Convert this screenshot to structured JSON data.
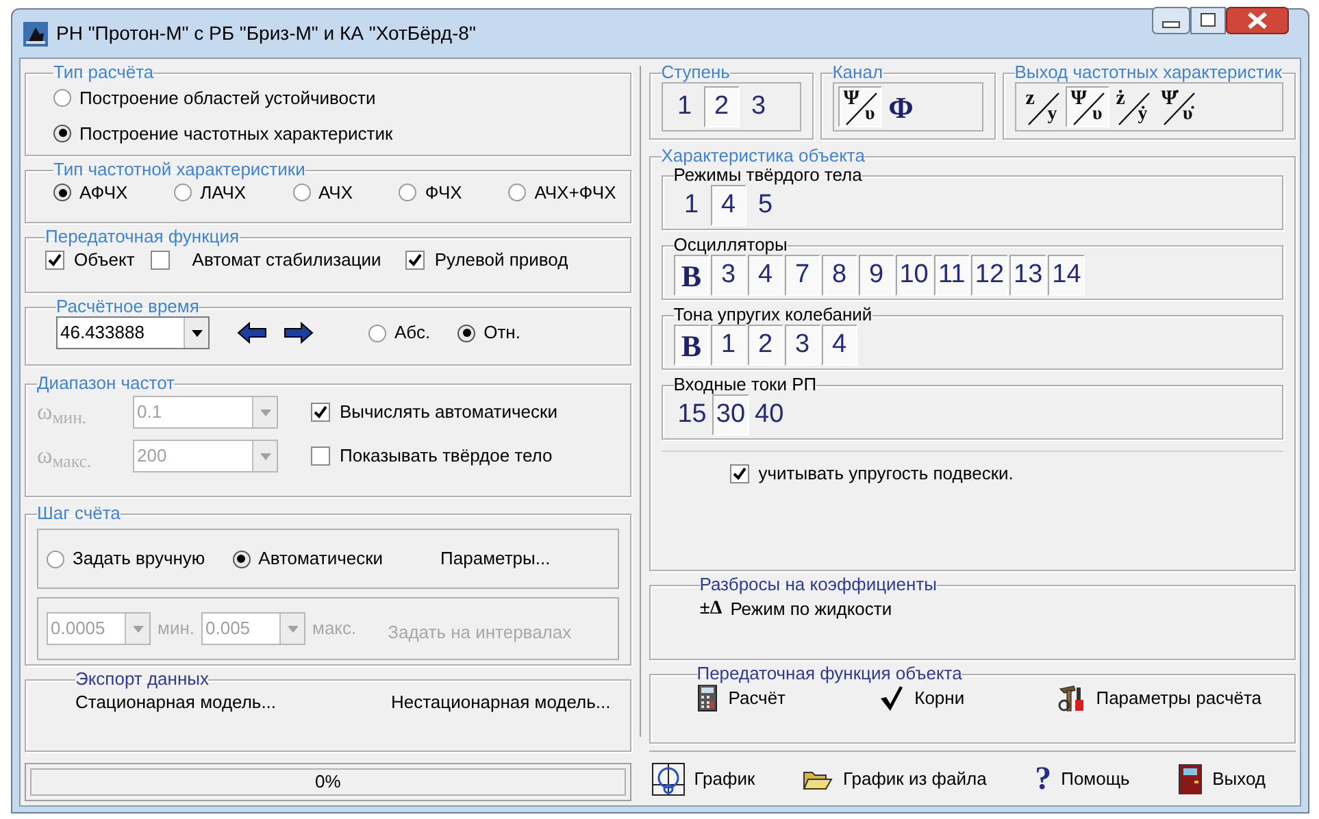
{
  "window": {
    "title": "РН \"Протон-М\" с РБ \"Бриз-М\" и КА \"ХотБёрд-8\""
  },
  "calc_type": {
    "legend": "Тип расчёта",
    "options": [
      {
        "label": "Построение областей устойчивости",
        "selected": false
      },
      {
        "label": "Построение частотных характеристик",
        "selected": true
      }
    ]
  },
  "freq_char_type": {
    "legend": "Тип частотной характеристики",
    "options": [
      {
        "label": "АФЧХ",
        "selected": true
      },
      {
        "label": "ЛАЧХ",
        "selected": false
      },
      {
        "label": "АЧХ",
        "selected": false
      },
      {
        "label": "ФЧХ",
        "selected": false
      },
      {
        "label": "АЧХ+ФЧХ",
        "selected": false
      }
    ]
  },
  "transfer_function": {
    "legend": "Передаточная функция",
    "items": [
      {
        "label": "Объект",
        "checked": true
      },
      {
        "label": "Автомат стабилизации",
        "checked": false
      },
      {
        "label": "Рулевой привод",
        "checked": true
      }
    ]
  },
  "calc_time": {
    "legend": "Расчётное время",
    "value": "46.433888",
    "modes": [
      {
        "label": "Абс.",
        "selected": false
      },
      {
        "label": "Отн.",
        "selected": true
      }
    ]
  },
  "freq_range": {
    "legend": "Диапазон частот",
    "fields": [
      {
        "label": "ω$_{мин.}$",
        "value": "0.1",
        "disabled": true
      },
      {
        "label": "ω$_{макс.}$",
        "value": "200",
        "disabled": true
      }
    ],
    "options": [
      {
        "label": "Вычислять автоматически",
        "checked": true
      },
      {
        "label": "Показывать твёрдое тело",
        "checked": false
      }
    ]
  },
  "step": {
    "legend": "Шаг счёта",
    "modes": [
      {
        "label": "Задать вручную",
        "selected": false
      },
      {
        "label": "Автоматически",
        "selected": true
      }
    ],
    "params_button": "Параметры...",
    "fields": [
      {
        "value": "0.0005",
        "unit": "мин.",
        "disabled": true
      },
      {
        "value": "0.005",
        "unit": "макс.",
        "disabled": true
      }
    ],
    "interval_button": {
      "label": "Задать на интервалах",
      "disabled": true
    }
  },
  "export": {
    "legend": "Экспорт данных",
    "buttons": [
      "Стационарная модель...",
      "Нестационарная модель..."
    ]
  },
  "progress": {
    "level": 0,
    "text": "0%"
  },
  "stage": {
    "legend": "Ступень",
    "buttons": [
      {
        "kind": "digit",
        "label": "1",
        "selected": false
      },
      {
        "kind": "digit",
        "label": "2",
        "selected": true
      },
      {
        "kind": "digit",
        "label": "3",
        "selected": false
      }
    ]
  },
  "channel": {
    "legend": "Канал",
    "buttons": [
      {
        "kind": "fraction",
        "num": "Ψ",
        "den": "υ",
        "selected": true
      },
      {
        "kind": "symbol",
        "label": "Φ",
        "selected": false
      }
    ]
  },
  "output": {
    "legend": "Выход частотных характеристик",
    "buttons": [
      {
        "kind": "fraction",
        "num": "z",
        "den": "y",
        "selected": false
      },
      {
        "kind": "fraction",
        "num": "Ψ",
        "den": "υ",
        "selected": true
      },
      {
        "kind": "fraction",
        "num": "ż",
        "den": "ẏ",
        "selected": false
      },
      {
        "kind": "fraction",
        "num": "Ψ̇",
        "den": "υ̇",
        "selected": false
      }
    ]
  },
  "object": {
    "legend": "Характеристика объекта",
    "groups": [
      {
        "label": "Режимы твёрдого тела",
        "buttons": [
          {
            "kind": "digit",
            "label": "1",
            "selected": false
          },
          {
            "kind": "digit",
            "label": "4",
            "selected": true
          },
          {
            "kind": "digit",
            "label": "5",
            "selected": false
          }
        ]
      },
      {
        "label": "Осцилляторы",
        "buttons": [
          {
            "kind": "symbol",
            "label": "B",
            "selected": true
          },
          {
            "kind": "digit",
            "label": "3",
            "selected": true
          },
          {
            "kind": "digit",
            "label": "4",
            "selected": true
          },
          {
            "kind": "digit",
            "label": "7",
            "selected": true
          },
          {
            "kind": "digit",
            "label": "8",
            "selected": true
          },
          {
            "kind": "digit",
            "label": "9",
            "selected": true
          },
          {
            "kind": "digit",
            "label": "10",
            "selected": true
          },
          {
            "kind": "digit",
            "label": "11",
            "selected": true
          },
          {
            "kind": "digit",
            "label": "12",
            "selected": true
          },
          {
            "kind": "digit",
            "label": "13",
            "selected": true
          },
          {
            "kind": "digit",
            "label": "14",
            "selected": true
          }
        ]
      },
      {
        "label": "Тона упругих колебаний",
        "buttons": [
          {
            "kind": "symbol",
            "label": "B",
            "selected": true
          },
          {
            "kind": "digit",
            "label": "1",
            "selected": true
          },
          {
            "kind": "digit",
            "label": "2",
            "selected": true
          },
          {
            "kind": "digit",
            "label": "3",
            "selected": true
          },
          {
            "kind": "digit",
            "label": "4",
            "selected": true
          }
        ]
      },
      {
        "label": "Входные токи РП",
        "buttons": [
          {
            "kind": "digit",
            "label": "15",
            "selected": false
          },
          {
            "kind": "digit",
            "label": "30",
            "selected": true
          },
          {
            "kind": "digit",
            "label": "40",
            "selected": false
          }
        ]
      }
    ],
    "elastic_suspension": {
      "label": "учитывать упругость подвески.",
      "checked": true
    }
  },
  "spread": {
    "legend": "Разбросы на коэффициенты",
    "button": {
      "icon_text": "±Δ",
      "label": "Режим по жидкости"
    }
  },
  "object_tf": {
    "legend": "Передаточная функция объекта",
    "buttons": [
      {
        "kind": "calculator",
        "label": "Расчёт"
      },
      {
        "kind": "check",
        "label": "Корни"
      },
      {
        "kind": "tools",
        "label": "Параметры расчёта"
      }
    ]
  },
  "toolbar": [
    {
      "kind": "graph",
      "label": "График"
    },
    {
      "kind": "folder",
      "label": "График из файла"
    },
    {
      "kind": "help",
      "icon_text": "?",
      "label": "Помощь"
    },
    {
      "kind": "door",
      "label": "Выход"
    }
  ]
}
